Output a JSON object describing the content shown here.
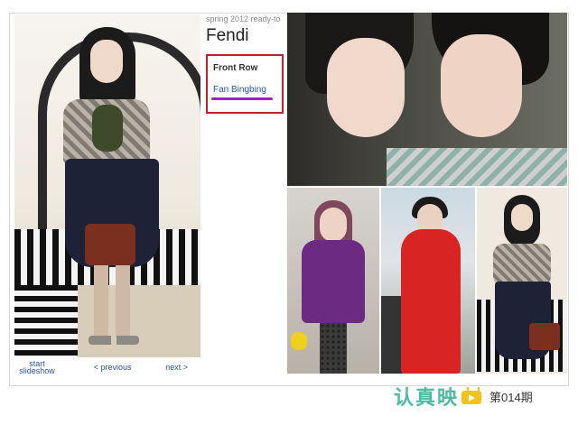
{
  "info_panel": {
    "season": "spring 2012 ready-to",
    "brand": "Fendi",
    "front_row_label": "Front Row",
    "front_row_name": "Fan Bingbing"
  },
  "slideshow": {
    "start_label_line1": "start",
    "start_label_line2": "slideshow",
    "previous_label": "< previous",
    "next_label": "next >"
  },
  "logo": {
    "text_left": "认真映",
    "issue": "第014期",
    "icon": "tv-icon"
  },
  "colors": {
    "highlight_box": "#c4202c",
    "underline": "#a020d0",
    "link": "#2a55a5",
    "logo_green": "#4fb9a2",
    "logo_yellow": "#f3c21b"
  }
}
